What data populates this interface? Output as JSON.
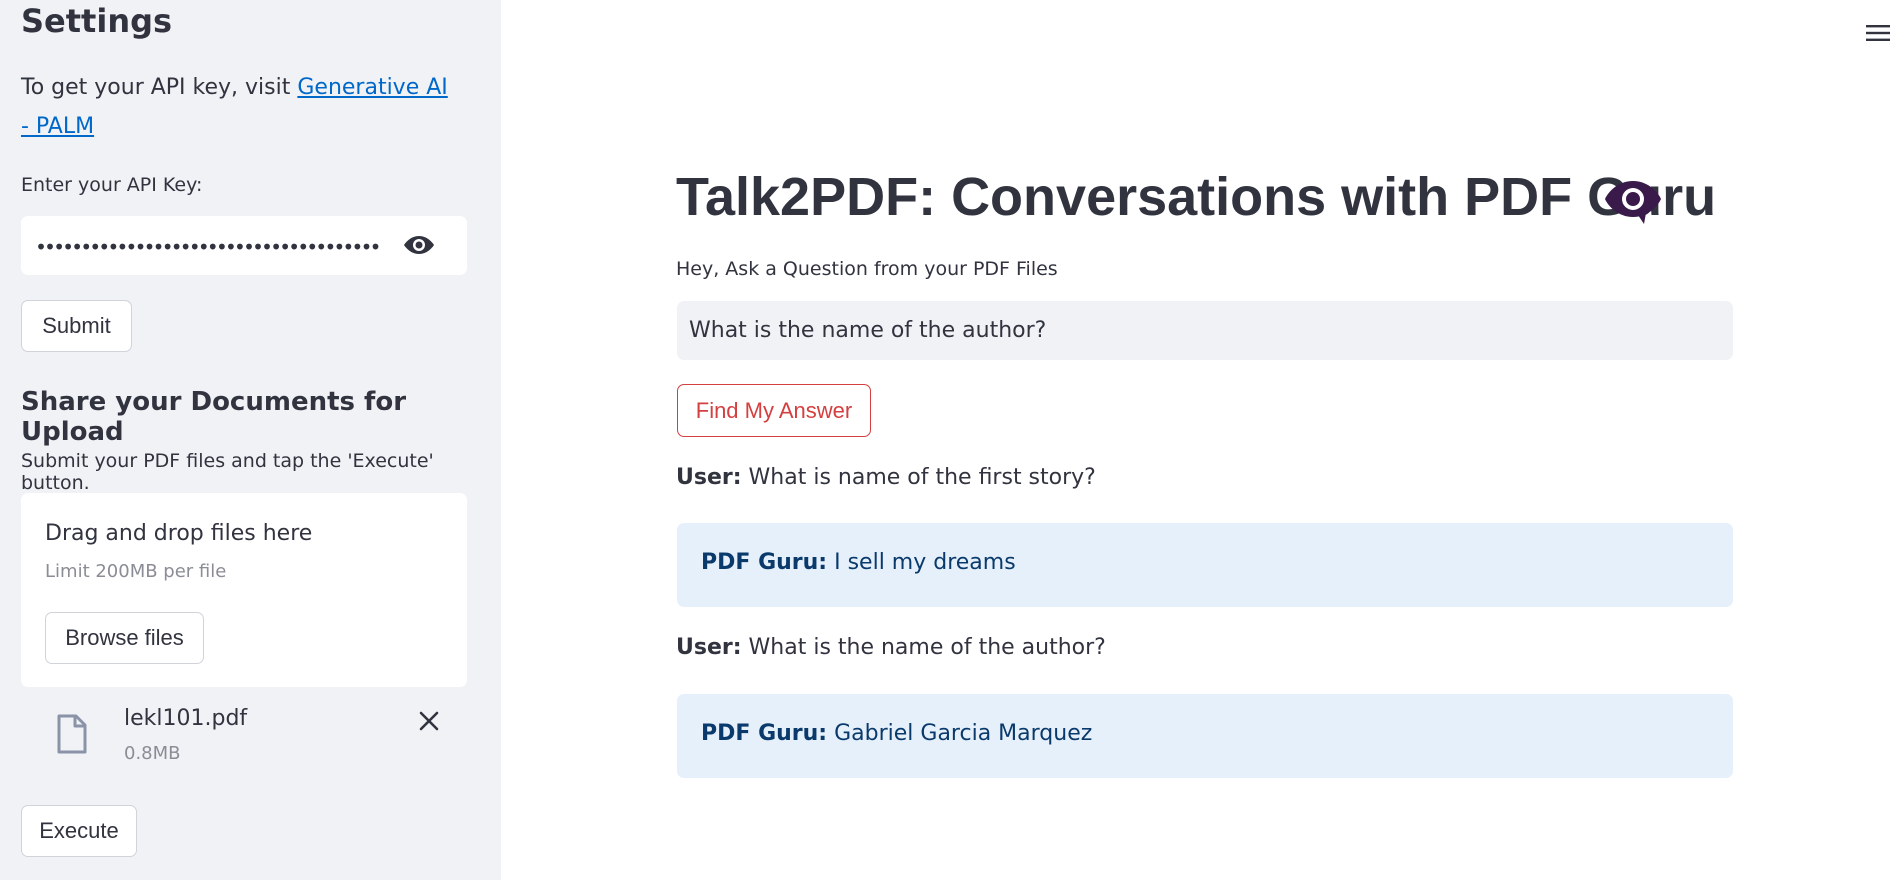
{
  "sidebar": {
    "title": "Settings",
    "api_help_prefix": "To get your API key, visit ",
    "api_help_link": "Generative AI - PALM",
    "api_key_label": "Enter your API Key:",
    "api_key_value": "••••••••••••••••••••••••••••••••••••••",
    "submit_label": "Submit",
    "upload_title": "Share your Documents for Upload",
    "upload_desc": "Submit your PDF files and tap the 'Execute' button.",
    "dropzone": {
      "title": "Drag and drop files here",
      "limit": "Limit 200MB per file",
      "browse_label": "Browse files"
    },
    "file": {
      "name": "lekl101.pdf",
      "size": "0.8MB",
      "icon": "file-icon"
    },
    "execute_label": "Execute"
  },
  "main": {
    "title": "Talk2PDF: Conversations with PDF Guru",
    "title_icon": "eye-icon",
    "subtitle": "Hey, Ask a Question from your PDF Files",
    "question_value": "What is the name of the author?",
    "find_label": "Find My Answer",
    "messages": [
      {
        "role": "User:",
        "text": "What is name of the first story?"
      },
      {
        "role": "PDF Guru:",
        "text": "I sell my dreams"
      },
      {
        "role": "User:",
        "text": "What is the name of the author?"
      },
      {
        "role": "PDF Guru:",
        "text": "Gabriel Garcia Marquez"
      }
    ]
  },
  "colors": {
    "sidebar_bg": "#f0f2f6",
    "link": "#0068c9",
    "find_button": "#d43f3f",
    "bot_bubble_bg": "#e6f0fb",
    "bot_text": "#0a3a6b",
    "title_icon": "#3a1a4a"
  }
}
